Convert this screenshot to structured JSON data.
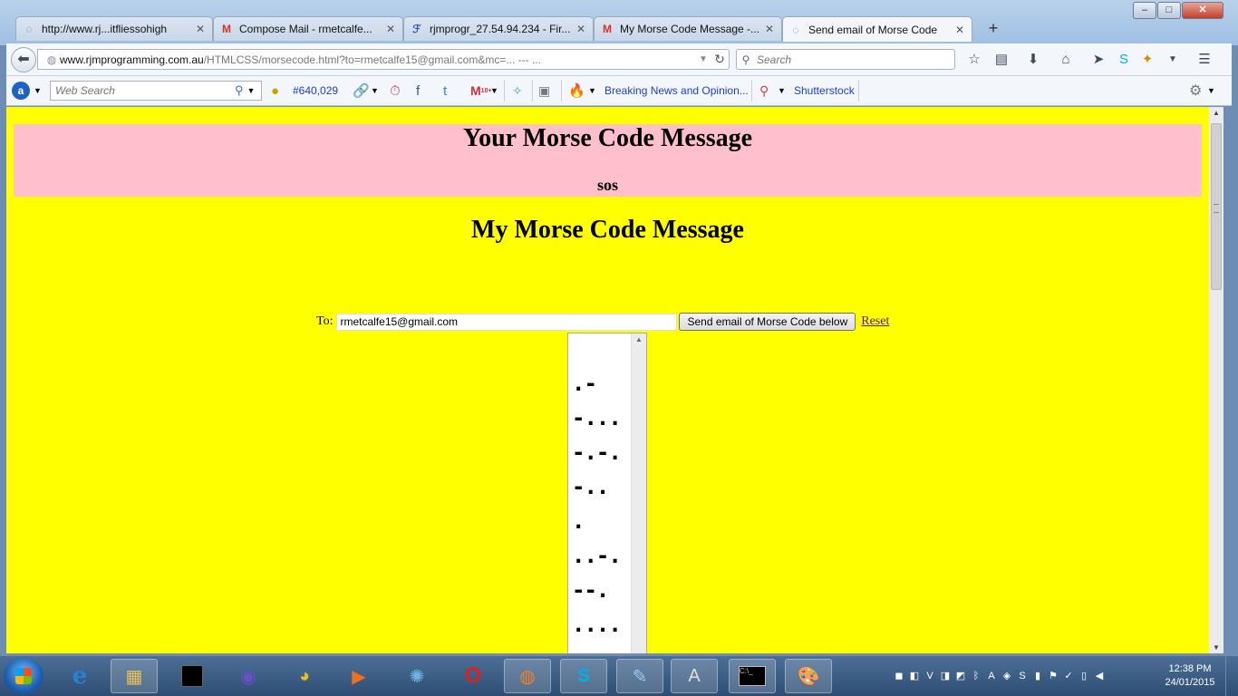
{
  "window": {
    "minimize": "–",
    "maximize": "□",
    "close": "✕"
  },
  "tabs": [
    {
      "label": "http://www.rj...itfliessohigh",
      "icon": "page-icon"
    },
    {
      "label": "Compose Mail - rmetcalfe...",
      "icon": "gmail-icon"
    },
    {
      "label": "rjmprogr_27.54.94.234 - Fir...",
      "icon": "filezilla-icon"
    },
    {
      "label": "My Morse Code Message -...",
      "icon": "gmail-icon"
    },
    {
      "label": "Send email of Morse Code",
      "icon": "page-icon",
      "active": true
    }
  ],
  "new_tab_label": "+",
  "nav": {
    "url_host": "www.rjmprogramming.com.au",
    "url_path": "/HTMLCSS/morsecode.html?to=rmetcalfe15@gmail.com&mc=... --- ...",
    "search_placeholder": "Search"
  },
  "toolbar": {
    "websearch_placeholder": "Web Search",
    "rank": "#640,029",
    "breaking_news": "Breaking News and Opinion...",
    "shutterstock": "Shutterstock",
    "mail_badge": "10+"
  },
  "page": {
    "banner_title": "Your Morse Code Message",
    "banner_message": "sos",
    "heading": "My Morse Code Message",
    "to_label": "To:",
    "to_value": "rmetcalfe15@gmail.com",
    "send_button": "Send email of Morse Code below",
    "reset_link": "Reset",
    "morse_lines": [
      ".-",
      "-...",
      "-.-.",
      "-..",
      ".",
      "..-.",
      "--.",
      "...."
    ]
  },
  "taskbar": {
    "time": "12:38 PM",
    "date": "24/01/2015"
  },
  "colors": {
    "page_background": "#ffff00",
    "banner_background": "#ffc0cb"
  }
}
